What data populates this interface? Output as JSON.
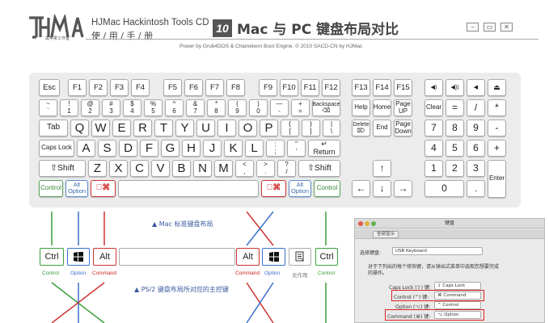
{
  "header": {
    "brand_name": "HJMac Hackintosh Tools CD",
    "brand_sub": "使  /  用  /  手  /  册",
    "logo_sub": "黑苹果工作室",
    "chapter_number": "10",
    "title": "Mac 与 PC 键盘布局对比",
    "powered_by": "Power by Grub4DOS & Chameleon Boot Engine. © 2010 SACD-CN by HJMac",
    "window_buttons": [
      "–",
      "▭",
      "✕"
    ]
  },
  "keyboard": {
    "row_fn": [
      "Esc",
      "F1",
      "F2",
      "F3",
      "F4",
      "F5",
      "F6",
      "F7",
      "F8",
      "F9",
      "F10",
      "F11",
      "F12",
      "F13",
      "F14",
      "F15"
    ],
    "row_fn_media": [
      "◀)",
      "◀))",
      "◀",
      "⏏"
    ],
    "row_num": [
      [
        "~",
        "`"
      ],
      [
        "!",
        "1"
      ],
      [
        "@",
        "2"
      ],
      [
        "#",
        "3"
      ],
      [
        "$",
        "4"
      ],
      [
        "%",
        "5"
      ],
      [
        "^",
        "6"
      ],
      [
        "&",
        "7"
      ],
      [
        "*",
        "8"
      ],
      [
        "(",
        "9"
      ],
      [
        ")",
        "0"
      ],
      [
        "—",
        "-"
      ],
      [
        "+",
        "="
      ]
    ],
    "backspace": [
      "Backspace",
      "⌫"
    ],
    "nav1": [
      "Help",
      "Home",
      [
        "Page",
        "UP"
      ]
    ],
    "num1": [
      "Clear",
      "=",
      "/",
      "*"
    ],
    "tab": "Tab",
    "row_q": [
      "Q",
      "W",
      "E",
      "R",
      "T",
      "Y",
      "U",
      "I",
      "O",
      "P"
    ],
    "row_q_sym": [
      [
        "{",
        "["
      ],
      [
        "}",
        "]"
      ],
      [
        "|",
        "\\"
      ]
    ],
    "nav2": [
      [
        "Delete",
        "⌦"
      ],
      "End",
      [
        "Page",
        "Down"
      ]
    ],
    "num2": [
      "7",
      "8",
      "9",
      "-"
    ],
    "caps": "Caps Lock",
    "row_a": [
      "A",
      "S",
      "D",
      "F",
      "G",
      "H",
      "J",
      "K",
      "L"
    ],
    "row_a_sym": [
      [
        ":",
        ";"
      ],
      [
        "\"",
        "'"
      ]
    ],
    "return": [
      "↵",
      "Return"
    ],
    "num3": [
      "4",
      "5",
      "6",
      "+"
    ],
    "shift": "⇧Shift",
    "row_z": [
      "Z",
      "X",
      "C",
      "V",
      "B",
      "N",
      "M"
    ],
    "row_z_sym": [
      [
        "<",
        ","
      ],
      [
        ">",
        "."
      ],
      [
        "?",
        "/"
      ]
    ],
    "arrow_up": "↑",
    "num4": [
      "1",
      "2",
      "3"
    ],
    "enter": "Enter",
    "control": "Control",
    "alt": "Alt",
    "option": "Option",
    "cmd": "⌘",
    "arrows": [
      "←",
      "↓",
      "→"
    ],
    "num5": [
      "0",
      "."
    ]
  },
  "lower": {
    "note_mac": "▲ Mac 标准键盘布局",
    "note_pc": "▲ PS/2 键盘布局所对应的主控键",
    "keys": {
      "ctrl": "Ctrl",
      "alt": "Alt"
    },
    "captions": {
      "control": "Control",
      "option": "Option",
      "command": "Command",
      "none": "无作用"
    },
    "colors": {
      "control": "#3a9a3a",
      "option": "#3a6acc",
      "command": "#cc2222"
    }
  },
  "dialog": {
    "title": "键盘",
    "tab": "全部显示",
    "select_keyboard_label": "选择键盘:",
    "select_keyboard_value": "USB Keyboard",
    "desc1": "对于下列出的每个修饰键，请从弹出式菜单中选取您想要完成",
    "desc2": "的操作。",
    "rows": [
      {
        "label": "Caps Lock (⇪) 键:",
        "value": "⇪ Caps Lock"
      },
      {
        "label": "Control (^) 键:",
        "value": "⌘ Command"
      },
      {
        "label": "Option (⌥) 键:",
        "value": "^ Control"
      },
      {
        "label": "Command (⌘) 键:",
        "value": "⌥ Option"
      }
    ]
  }
}
